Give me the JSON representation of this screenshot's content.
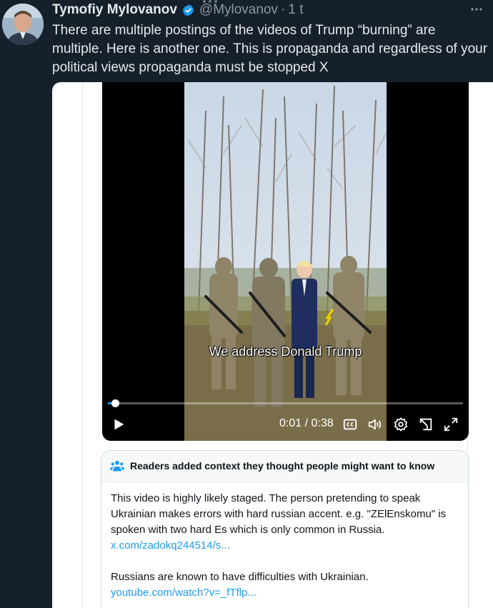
{
  "tweet": {
    "author_name": "Tymofiy Mylovanov",
    "handle": "@Mylovanov",
    "separator": "·",
    "time": "1 t",
    "more_icon": "more-horizontal-icon",
    "text": "There are multiple postings of the videos of Trump “burning” are multiple. Here is another one. This is propaganda and regardless of your political views propaganda must be stopped X"
  },
  "video": {
    "caption": "We address Donald Trump",
    "current_time": "0:01",
    "duration": "0:38",
    "timecode_separator": " / ",
    "progress_fraction": 0.021,
    "icons": [
      "play-icon",
      "captions-icon",
      "volume-icon",
      "settings-icon",
      "pip-icon",
      "fullscreen-icon"
    ]
  },
  "community_note": {
    "title": "Readers added context they thought people might want to know",
    "paragraph1": "This video is highly likely staged. The person pretending to speak Ukrainian makes errors with hard russian accent. e.g. \"ZElEnskomu\" is spoken with two hard Es which is only common in Russia.",
    "link1": "x.com/zadokq244514/s...",
    "paragraph2": "Russians are known to have difficulties with Ukrainian.",
    "link2": "youtube.com/watch?v=_fTflp..."
  },
  "colors": {
    "background": "#15202b",
    "accent": "#1d9bf0",
    "muted_text": "#8b98a5"
  }
}
